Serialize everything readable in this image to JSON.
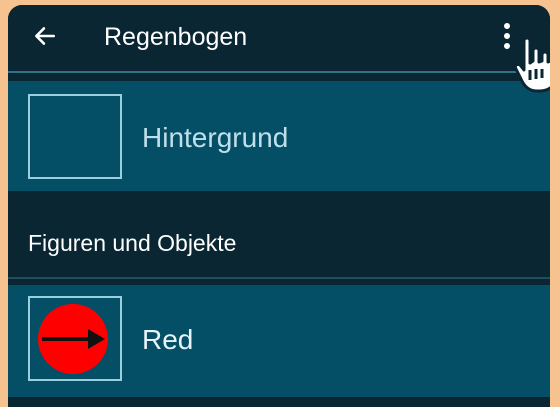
{
  "appbar": {
    "title": "Regenbogen",
    "back_icon": "arrow-left-icon",
    "menu_icon": "more-vertical-icon"
  },
  "items": {
    "background": {
      "label": "Hintergrund",
      "thumbnail": "empty"
    },
    "section_title": "Figuren und Objekte",
    "object": {
      "label": "Red",
      "thumbnail": "red-circle-arrow",
      "color": "#ff0000"
    }
  },
  "overlay": {
    "pointer_icon": "hand-pointer-icon"
  },
  "colors": {
    "frame": "#f6c28f",
    "dark": "#0a2633",
    "row": "#044f66",
    "accent": "#9ccfde"
  }
}
